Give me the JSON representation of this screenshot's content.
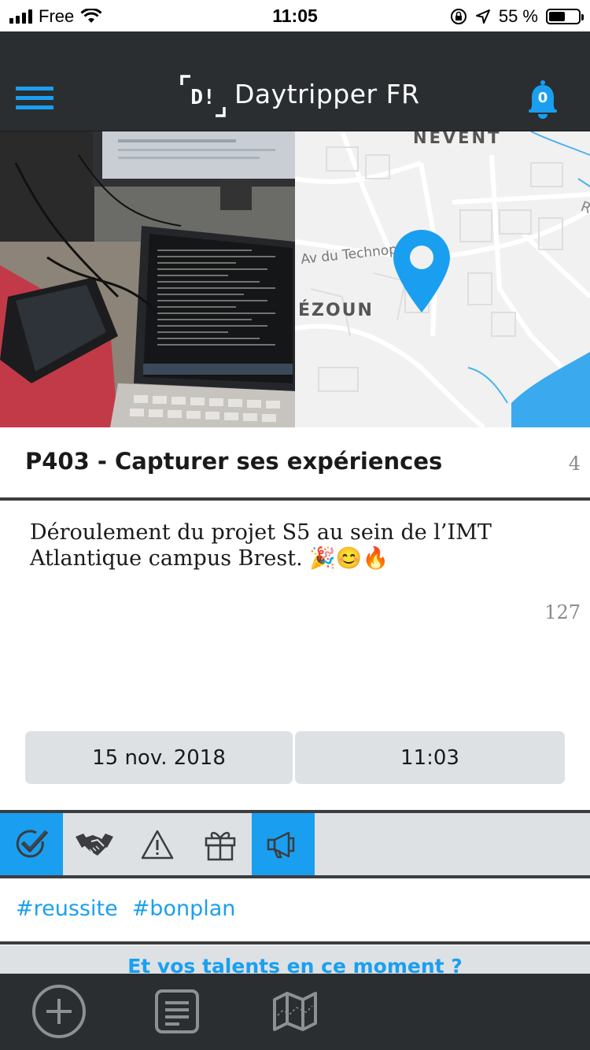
{
  "status_bar": {
    "carrier": "Free",
    "time": "11:05",
    "battery_percent": "55 %",
    "battery_level": 0.55
  },
  "header": {
    "logo_text": "D!",
    "title": "Daytripper FR",
    "notification_count": "0"
  },
  "map": {
    "labels": {
      "north": "NEVENT",
      "road": "Av du Technopôle",
      "west": "ÉZOUN",
      "edge": "R"
    },
    "pin_icon": "map-pin-icon"
  },
  "post": {
    "title": "P403 - Capturer ses expériences",
    "title_count": "4",
    "description": "Déroulement du projet S5 au sein de l’IMT Atlantique campus Brest. 🎉😊🔥",
    "description_count": "127",
    "date": "15 nov. 2018",
    "time": "11:03"
  },
  "categories": [
    {
      "icon": "checkmark-icon",
      "active": true
    },
    {
      "icon": "handshake-icon",
      "active": false
    },
    {
      "icon": "warning-icon",
      "active": false
    },
    {
      "icon": "gift-icon",
      "active": false
    },
    {
      "icon": "megaphone-icon",
      "active": true
    }
  ],
  "tags": [
    "#reussite",
    "#bonplan"
  ],
  "talents_prompt": "Et vos talents en ce moment ?",
  "tab_bar": [
    {
      "icon": "add-icon"
    },
    {
      "icon": "document-icon"
    },
    {
      "icon": "map-icon"
    }
  ],
  "colors": {
    "accent": "#1a9ff0",
    "nav_bg": "#2b2e31",
    "panel_bg": "#dde1e4"
  }
}
